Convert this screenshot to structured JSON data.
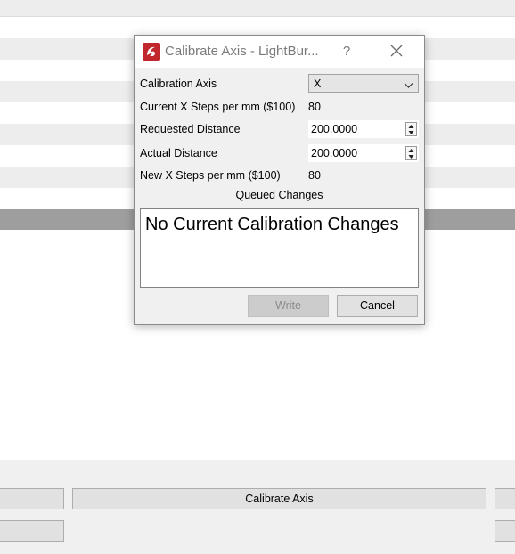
{
  "dialog": {
    "title": "Calibrate Axis - LightBur...",
    "help_glyph": "?",
    "close_icon": "close-icon",
    "app_icon": "lightburn-logo-icon",
    "rows": {
      "axis_label": "Calibration Axis",
      "axis_value": "X",
      "current_steps_label": "Current X Steps per mm ($100)",
      "current_steps_value": "80",
      "requested_label": "Requested Distance",
      "requested_value": "200.0000",
      "actual_label": "Actual Distance",
      "actual_value": "200.0000",
      "new_steps_label": "New X Steps per mm ($100)",
      "new_steps_value": "80"
    },
    "queued_header": "Queued Changes",
    "queued_text": "No Current Calibration Changes",
    "write_label": "Write",
    "cancel_label": "Cancel"
  },
  "background": {
    "calibrate_button_label": "Calibrate Axis"
  },
  "colors": {
    "logo_red": "#c0282d",
    "title_gray": "#7a7a7a",
    "disabled_bg": "#cccccc"
  }
}
